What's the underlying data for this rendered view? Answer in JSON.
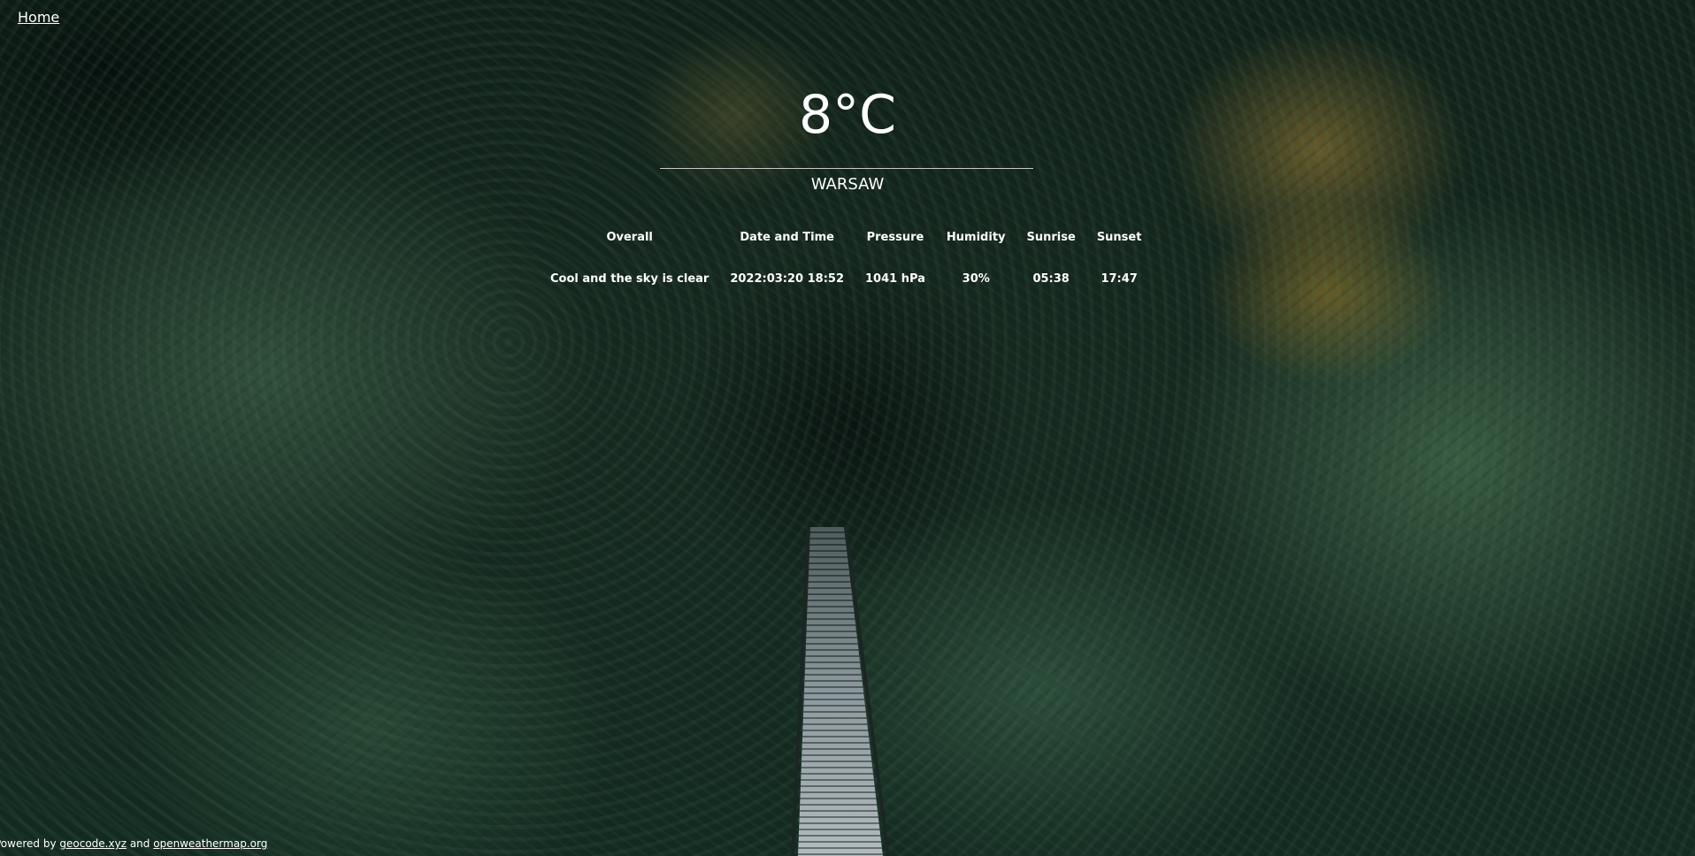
{
  "nav": {
    "home_label": "Home"
  },
  "weather": {
    "temperature": "8°C",
    "city": "WARSAW",
    "table": {
      "headers": [
        "Overall",
        "Date and Time",
        "Pressure",
        "Humidity",
        "Sunrise",
        "Sunset"
      ],
      "row": [
        "Cool and the sky is clear",
        "2022:03:20 18:52",
        "1041 hPa",
        "30%",
        "05:38",
        "17:47"
      ]
    }
  },
  "footer": {
    "prefix": "Powered by",
    "link1": "geocode.xyz",
    "joiner": "and",
    "link2": "openweathermap.org"
  },
  "background": {
    "description_icon": "forest-bridge-photo",
    "accent_text_color": "#ffffff",
    "divider_color": "#c9c9c9"
  }
}
